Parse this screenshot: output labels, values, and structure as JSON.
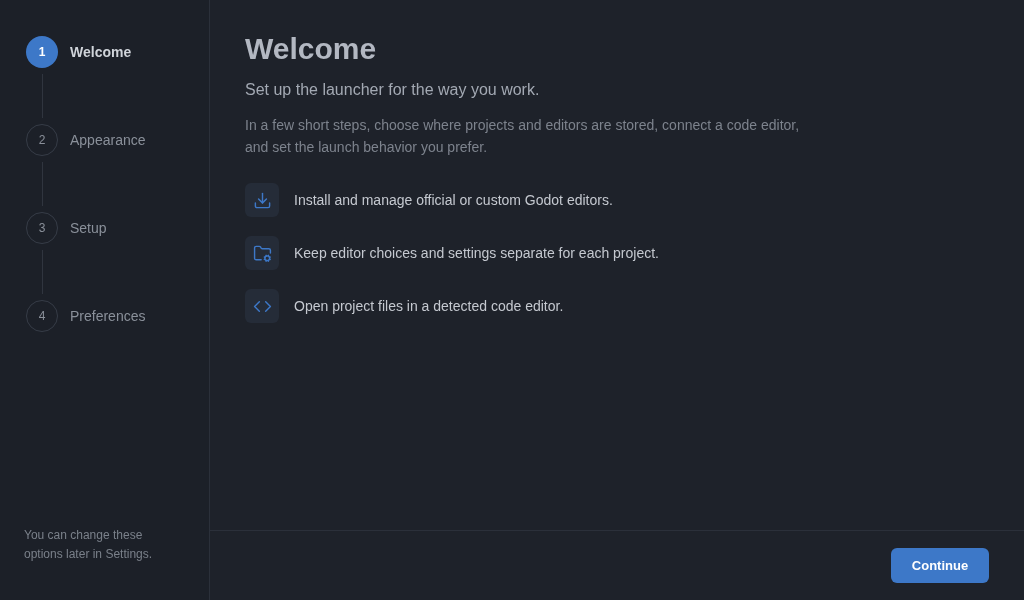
{
  "steps": [
    {
      "number": "1",
      "label": "Welcome",
      "selected": true
    },
    {
      "number": "2",
      "label": "Appearance",
      "selected": false
    },
    {
      "number": "3",
      "label": "Setup",
      "selected": false
    },
    {
      "number": "4",
      "label": "Preferences",
      "selected": false
    }
  ],
  "sidebar_note": "You can change these options later in Settings.",
  "heading": "Welcome",
  "subtitle": "Set up the launcher for the way you work.",
  "description": "In a few short steps, choose where projects and editors are stored, connect a code editor, and set the launch behavior you prefer.",
  "features": [
    {
      "kind": "download",
      "text": "Install and manage official or custom Godot editors."
    },
    {
      "kind": "folder-settings",
      "text": "Keep editor choices and settings separate for each project."
    },
    {
      "kind": "code",
      "text": "Open project files in a detected code editor."
    }
  ],
  "continue_button": "Continue"
}
